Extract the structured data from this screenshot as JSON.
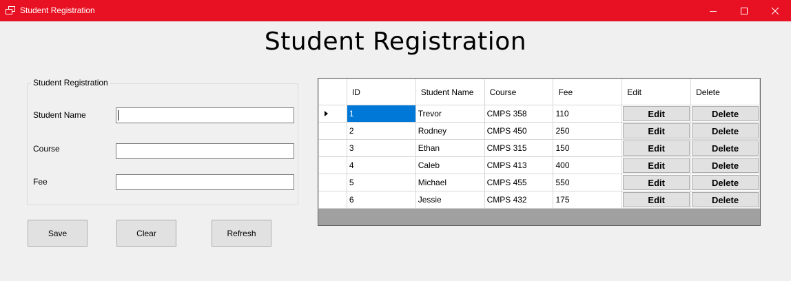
{
  "window": {
    "title": "Student Registration",
    "accent_color": "#e81123"
  },
  "page": {
    "heading": "Student Registration"
  },
  "form": {
    "group_label": "Student Registration",
    "fields": [
      {
        "label": "Student Name",
        "value": ""
      },
      {
        "label": "Course",
        "value": ""
      },
      {
        "label": "Fee",
        "value": ""
      }
    ],
    "buttons": {
      "save": "Save",
      "clear": "Clear",
      "refresh": "Refresh"
    }
  },
  "grid": {
    "columns": [
      "ID",
      "Student Name",
      "Course",
      "Fee",
      "Edit",
      "Delete"
    ],
    "selected_row": 0,
    "rows": [
      {
        "id": "1",
        "name": "Trevor",
        "course": "CMPS 358",
        "fee": "110",
        "edit": "Edit",
        "delete": "Delete"
      },
      {
        "id": "2",
        "name": "Rodney",
        "course": "CMPS 450",
        "fee": "250",
        "edit": "Edit",
        "delete": "Delete"
      },
      {
        "id": "3",
        "name": "Ethan",
        "course": "CMPS 315",
        "fee": "150",
        "edit": "Edit",
        "delete": "Delete"
      },
      {
        "id": "4",
        "name": "Caleb",
        "course": "CMPS 413",
        "fee": "400",
        "edit": "Edit",
        "delete": "Delete"
      },
      {
        "id": "5",
        "name": "Michael",
        "course": "CMPS 455",
        "fee": "550",
        "edit": "Edit",
        "delete": "Delete"
      },
      {
        "id": "6",
        "name": "Jessie",
        "course": "CMPS 432",
        "fee": "175",
        "edit": "Edit",
        "delete": "Delete"
      }
    ]
  }
}
